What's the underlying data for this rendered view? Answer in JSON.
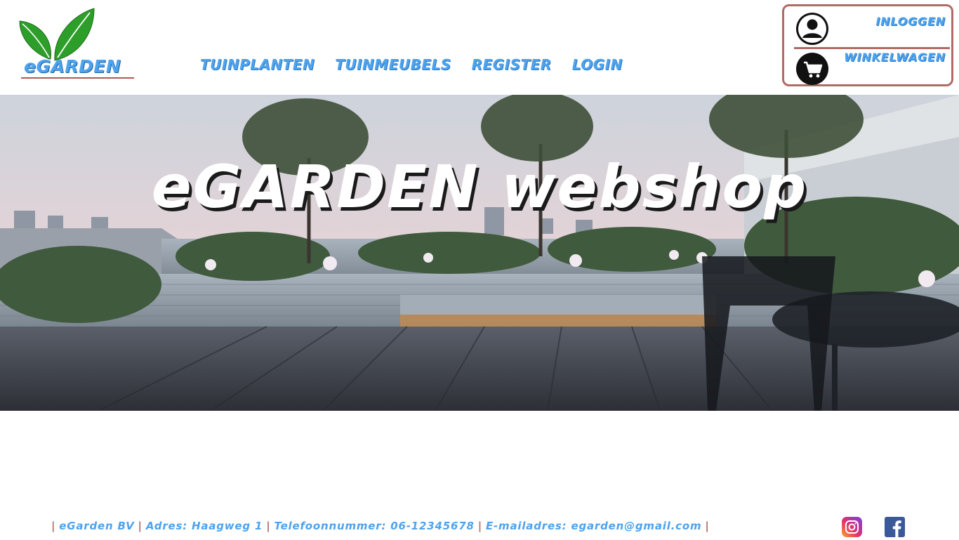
{
  "brand": {
    "logo_text": "eGARDEN"
  },
  "nav": {
    "items": [
      {
        "label": "TUINPLANTEN"
      },
      {
        "label": "TUINMEUBELS"
      },
      {
        "label": "REGISTER"
      },
      {
        "label": "LOGIN"
      }
    ]
  },
  "account": {
    "login_label": "INLOGGEN",
    "cart_label": "WINKELWAGEN",
    "icons": [
      "user-icon",
      "cart-icon"
    ]
  },
  "hero": {
    "title": "eGARDEN webshop"
  },
  "footer": {
    "company": "eGarden BV",
    "address": "Adres: Haagweg 1",
    "phone": "Telefoonnummer: 06-12345678",
    "email": "E-mailadres: egarden@gmail.com",
    "separator": "|",
    "social": [
      "instagram-icon",
      "facebook-icon"
    ]
  },
  "colors": {
    "accent": "#4da3ee",
    "border": "#b06b66",
    "leaf": "#2e9e2a"
  }
}
